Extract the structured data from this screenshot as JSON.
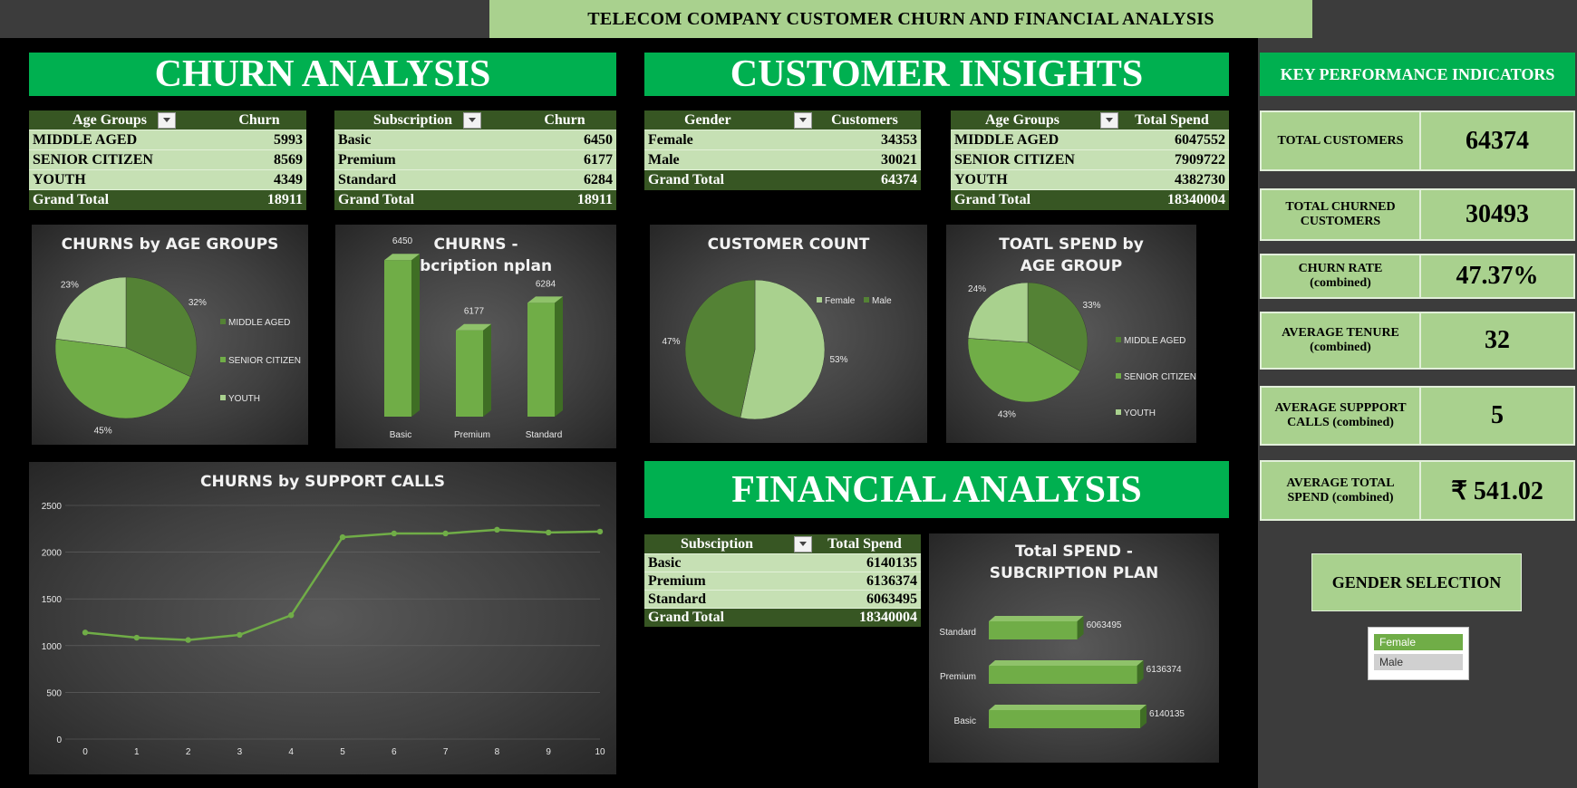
{
  "page_title": "TELECOM COMPANY CUSTOMER CHURN AND FINANCIAL ANALYSIS",
  "sections": {
    "churn": "CHURN ANALYSIS",
    "insights": "CUSTOMER INSIGHTS",
    "financial": "FINANCIAL ANALYSIS",
    "kpi": "KEY PERFORMANCE INDICATORS"
  },
  "colors": {
    "brand_green": "#00b050",
    "dark_green": "#375623",
    "light_green": "#c6e0b4",
    "kpi_green": "#a9d18e"
  },
  "tables": {
    "age_churn": {
      "col1": "Age Groups",
      "col2": "Churn",
      "rows": [
        {
          "label": "MIDDLE AGED",
          "value": "5993"
        },
        {
          "label": "SENIOR CITIZEN",
          "value": "8569"
        },
        {
          "label": "YOUTH",
          "value": "4349"
        }
      ],
      "total": {
        "label": "Grand Total",
        "value": "18911"
      }
    },
    "sub_churn": {
      "col1": "Subscription",
      "col2": "Churn",
      "rows": [
        {
          "label": "Basic",
          "value": "6450"
        },
        {
          "label": "Premium",
          "value": "6177"
        },
        {
          "label": "Standard",
          "value": "6284"
        }
      ],
      "total": {
        "label": "Grand Total",
        "value": "18911"
      }
    },
    "gender_customers": {
      "col1": "Gender",
      "col2": "Customers",
      "rows": [
        {
          "label": "Female",
          "value": "34353"
        },
        {
          "label": "Male",
          "value": "30021"
        }
      ],
      "total": {
        "label": "Grand Total",
        "value": "64374"
      }
    },
    "age_spend": {
      "col1": "Age Groups",
      "col2": "Total Spend",
      "rows": [
        {
          "label": "MIDDLE AGED",
          "value": "6047552"
        },
        {
          "label": "SENIOR CITIZEN",
          "value": "7909722"
        },
        {
          "label": "YOUTH",
          "value": "4382730"
        }
      ],
      "total": {
        "label": "Grand Total",
        "value": "18340004"
      }
    },
    "sub_spend": {
      "col1": "Subsciption",
      "col2": "Total Spend",
      "rows": [
        {
          "label": "Basic",
          "value": "6140135"
        },
        {
          "label": "Premium",
          "value": "6136374"
        },
        {
          "label": "Standard",
          "value": "6063495"
        }
      ],
      "total": {
        "label": "Grand Total",
        "value": "18340004"
      }
    }
  },
  "kpis": [
    {
      "label": "TOTAL CUSTOMERS",
      "value": "64374"
    },
    {
      "label": "TOTAL CHURNED CUSTOMERS",
      "value": "30493"
    },
    {
      "label": "CHURN RATE (combined)",
      "value": "47.37%"
    },
    {
      "label": "AVERAGE TENURE (combined)",
      "value": "32"
    },
    {
      "label": "AVERAGE SUPPPORT CALLS (combined)",
      "value": "5"
    },
    {
      "label": "AVERAGE TOTAL SPEND (combined)",
      "value": "₹ 541.02"
    }
  ],
  "gender_selection": {
    "label": "GENDER SELECTION",
    "options": [
      {
        "label": "Female",
        "selected": true
      },
      {
        "label": "Male",
        "selected": false
      }
    ]
  },
  "chart_data": [
    {
      "id": "age_pie",
      "type": "pie",
      "title": "CHURNS by AGE GROUPS",
      "categories": [
        "MIDDLE AGED",
        "SENIOR CITIZEN",
        "YOUTH"
      ],
      "values": [
        5993,
        8569,
        4349
      ],
      "labels": [
        "32%",
        "45%",
        "23%"
      ],
      "colors": [
        "#548235",
        "#70ad47",
        "#a9d18e"
      ],
      "legend": "right"
    },
    {
      "id": "sub_bar",
      "type": "bar",
      "title": "CHURNS - subcription nplan",
      "categories": [
        "Basic",
        "Premium",
        "Standard"
      ],
      "values": [
        6450,
        6177,
        6284
      ],
      "ylim": [
        6000,
        6500
      ]
    },
    {
      "id": "gender_pie",
      "type": "pie",
      "title": "CUSTOMER COUNT",
      "categories": [
        "Female",
        "Male"
      ],
      "values": [
        34353,
        30021
      ],
      "labels": [
        "53%",
        "47%"
      ],
      "colors": [
        "#a9d18e",
        "#548235"
      ],
      "legend": "top-right"
    },
    {
      "id": "spend_pie",
      "type": "pie",
      "title": "TOATL SPEND by AGE GROUP",
      "categories": [
        "MIDDLE AGED",
        "SENIOR CITIZEN",
        "YOUTH"
      ],
      "values": [
        6047552,
        7909722,
        4382730
      ],
      "labels": [
        "33%",
        "43%",
        "24%"
      ],
      "colors": [
        "#548235",
        "#70ad47",
        "#a9d18e"
      ],
      "legend": "right"
    },
    {
      "id": "support_line",
      "type": "line",
      "title": "CHURNS by SUPPORT CALLS",
      "x": [
        0,
        1,
        2,
        3,
        4,
        5,
        6,
        7,
        8,
        9,
        10
      ],
      "y": [
        1140,
        1085,
        1060,
        1115,
        1325,
        2160,
        2200,
        2200,
        2240,
        2210,
        2220
      ],
      "ylim": [
        0,
        2500
      ],
      "yticks": [
        0,
        500,
        1000,
        1500,
        2000,
        2500
      ],
      "grid": true
    },
    {
      "id": "spend_bar",
      "type": "bar",
      "orientation": "horizontal",
      "title": "Total SPEND - SUBCRIPTION PLAN",
      "categories": [
        "Standard",
        "Premium",
        "Basic"
      ],
      "values": [
        6063495,
        6136374,
        6140135
      ],
      "xlim": [
        6000000,
        6150000
      ]
    }
  ]
}
